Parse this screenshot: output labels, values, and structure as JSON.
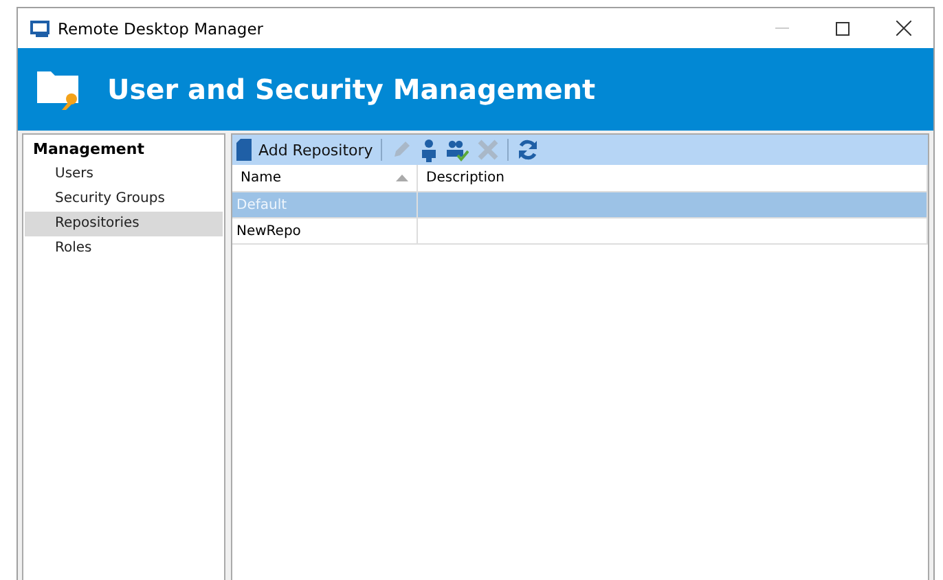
{
  "window": {
    "title": "Remote Desktop Manager"
  },
  "header": {
    "title": "User and Security Management"
  },
  "sidebar": {
    "heading": "Management",
    "items": [
      {
        "label": "Users",
        "selected": false
      },
      {
        "label": "Security Groups",
        "selected": false
      },
      {
        "label": "Repositories",
        "selected": true
      },
      {
        "label": "Roles",
        "selected": false
      }
    ]
  },
  "toolbar": {
    "items": [
      {
        "kind": "add",
        "label": "Add Repository",
        "disabled": false
      },
      {
        "kind": "edit",
        "disabled": true
      },
      {
        "kind": "user",
        "disabled": false
      },
      {
        "kind": "permissions",
        "disabled": false
      },
      {
        "kind": "delete",
        "disabled": true
      },
      {
        "kind": "refresh",
        "disabled": false
      }
    ]
  },
  "table": {
    "columns": [
      {
        "label": "Name",
        "sorted": true
      },
      {
        "label": "Description",
        "sorted": false
      }
    ],
    "rows": [
      {
        "cells": [
          "Default",
          ""
        ],
        "selected": true
      },
      {
        "cells": [
          "NewRepo",
          ""
        ],
        "selected": false
      }
    ]
  }
}
